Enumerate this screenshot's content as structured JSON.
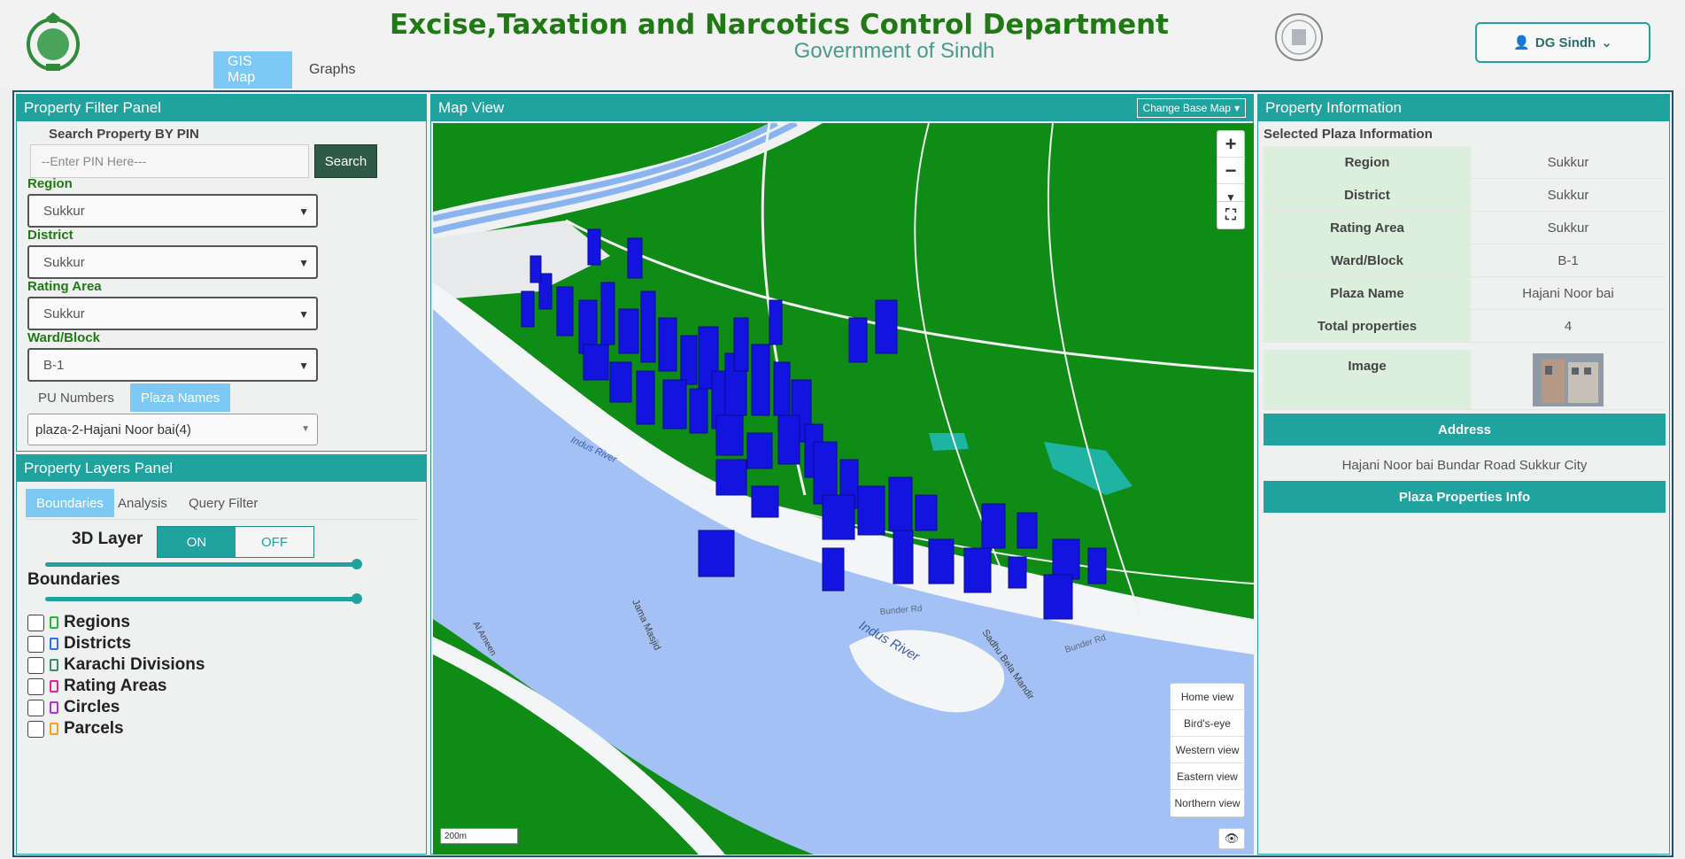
{
  "header": {
    "title": "Excise,Taxation and Narcotics Control Department",
    "subtitle": "Government of Sindh",
    "user_label": "DG Sindh",
    "tabs": [
      {
        "label": "GIS Map",
        "active": true
      },
      {
        "label": "Graphs",
        "active": false
      }
    ]
  },
  "filter_panel": {
    "title": "Property Filter Panel",
    "search_label": "Search Property BY PIN",
    "pin_placeholder": "--Enter PIN Here---",
    "search_button": "Search",
    "fields": [
      {
        "label": "Region",
        "value": "Sukkur"
      },
      {
        "label": "District",
        "value": "Sukkur"
      },
      {
        "label": "Rating Area",
        "value": "Sukkur"
      },
      {
        "label": "Ward/Block",
        "value": "B-1"
      }
    ],
    "tabs": [
      {
        "label": "PU Numbers",
        "active": false
      },
      {
        "label": "Plaza Names",
        "active": true
      }
    ],
    "plaza_value": "plaza-2-Hajani Noor bai(4)"
  },
  "layers_panel": {
    "title": "Property Layers Panel",
    "tabs": [
      {
        "label": "Boundaries",
        "active": true
      },
      {
        "label": "Analysis",
        "active": false
      },
      {
        "label": "Query Filter",
        "active": false
      }
    ],
    "layer3d_label": "3D Layer",
    "on_label": "ON",
    "off_label": "OFF",
    "boundaries_label": "Boundaries",
    "layers": [
      {
        "label": "Regions",
        "color": "#1fbb33"
      },
      {
        "label": "Districts",
        "color": "#2a6ff2"
      },
      {
        "label": "Karachi Divisions",
        "color": "#3a8a6e"
      },
      {
        "label": "Rating Areas",
        "color": "#e0219a"
      },
      {
        "label": "Circles",
        "color": "#b12fe3"
      },
      {
        "label": "Parcels",
        "color": "#f5a11a"
      }
    ]
  },
  "map": {
    "title": "Map View",
    "basemap_button": "Change Base Map",
    "zoom_in": "+",
    "zoom_out": "−",
    "labels": [
      "Indus River",
      "Indus River",
      "Bunder Rd",
      "Bunder Rd",
      "Jama Masjid",
      "Sadhu Bela Mandir",
      "Al Ameen"
    ],
    "scale": "200m",
    "views": [
      "Home view",
      "Bird's-eye",
      "Western view",
      "Eastern view",
      "Northern view"
    ]
  },
  "info_panel": {
    "title": "Property Information",
    "subtitle": "Selected Plaza Information",
    "rows": [
      {
        "key": "Region",
        "value": "Sukkur"
      },
      {
        "key": "District",
        "value": "Sukkur"
      },
      {
        "key": "Rating Area",
        "value": "Sukkur"
      },
      {
        "key": "Ward/Block",
        "value": "B-1"
      },
      {
        "key": "Plaza Name",
        "value": "Hajani Noor bai"
      },
      {
        "key": "Total properties",
        "value": "4"
      }
    ],
    "image_label": "Image",
    "address_header": "Address",
    "address_value": "Hajani Noor bai Bundar Road Sukkur City",
    "properties_button": "Plaza Properties Info"
  }
}
